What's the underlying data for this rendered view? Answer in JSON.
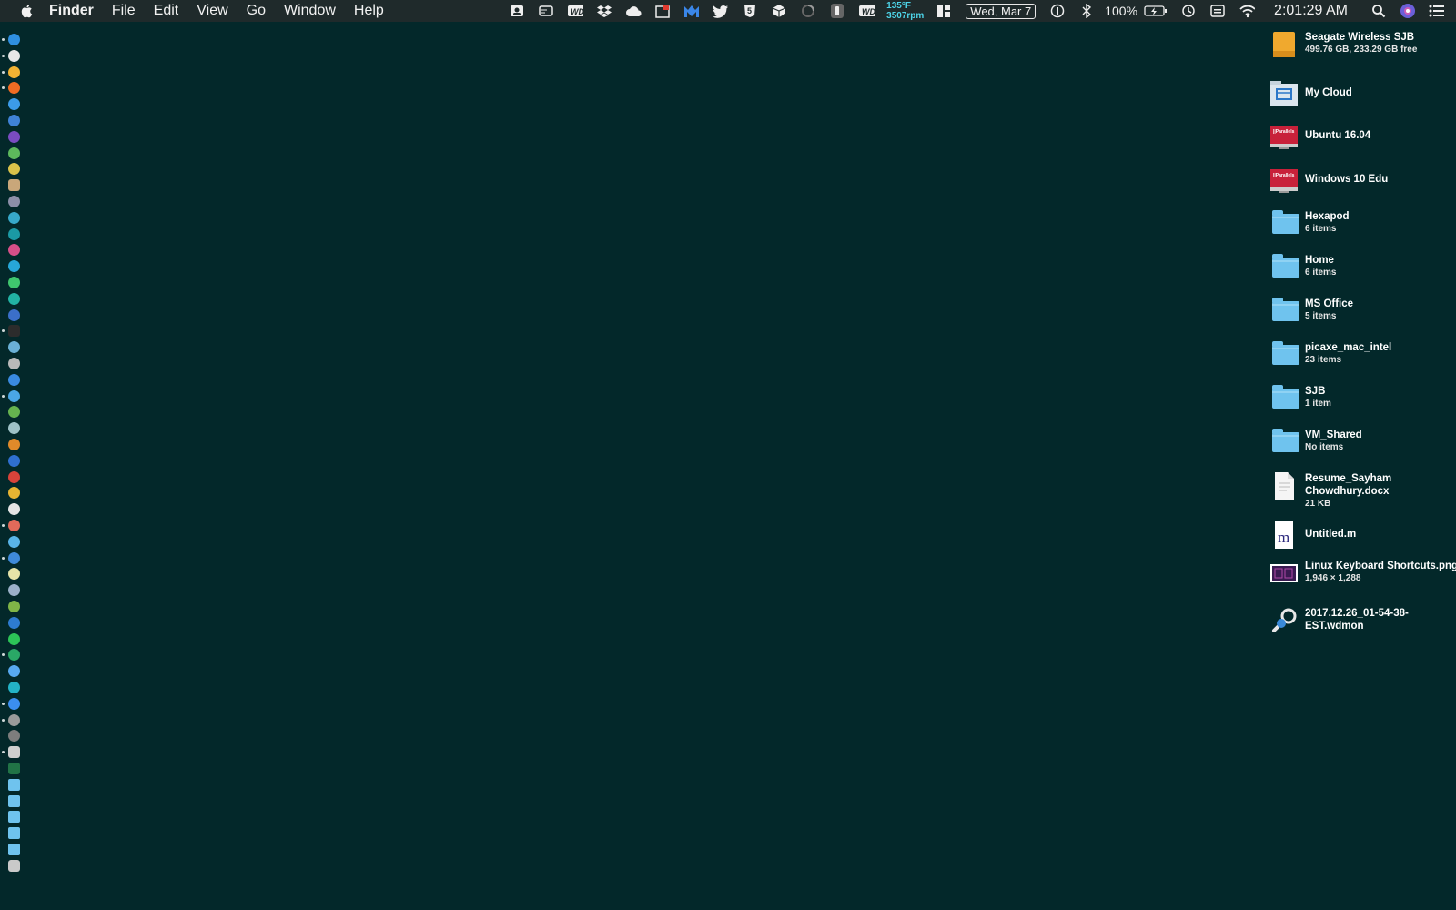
{
  "menubar": {
    "menus": [
      "Finder",
      "File",
      "Edit",
      "View",
      "Go",
      "Window",
      "Help"
    ],
    "status": {
      "temp": "135°F",
      "fan": "3507rpm",
      "date": "Wed, Mar 7",
      "battery": "100%",
      "time": "2:01:29 AM"
    }
  },
  "dock": {
    "apps": [
      {
        "name": "finder",
        "color": "#2f8fe0",
        "dot": true
      },
      {
        "name": "chrome-canary",
        "color": "#e8e8e8",
        "dot": true
      },
      {
        "name": "chrome",
        "color": "#f2b233",
        "dot": true
      },
      {
        "name": "firefox",
        "color": "#ef6b23",
        "dot": true
      },
      {
        "name": "safari",
        "color": "#3c9be8",
        "dot": false
      },
      {
        "name": "xcode",
        "color": "#3f82d6",
        "dot": false
      },
      {
        "name": "visual-studio",
        "color": "#7a4cc0",
        "dot": false
      },
      {
        "name": "app-green",
        "color": "#5db85c",
        "dot": false
      },
      {
        "name": "app-bee",
        "color": "#d9c24a",
        "dot": false
      },
      {
        "name": "preview",
        "color": "#c9a77a",
        "dot": false
      },
      {
        "name": "app-bar",
        "color": "#8c8fa8",
        "dot": false
      },
      {
        "name": "app-teal",
        "color": "#37a8c9",
        "dot": false
      },
      {
        "name": "arduino",
        "color": "#1b9aa4",
        "dot": false
      },
      {
        "name": "intellij",
        "color": "#d64f88",
        "dot": false
      },
      {
        "name": "webstorm",
        "color": "#27a7d8",
        "dot": false
      },
      {
        "name": "pycharm",
        "color": "#3fc66e",
        "dot": false
      },
      {
        "name": "clion",
        "color": "#22b3a4",
        "dot": false
      },
      {
        "name": "app-blue",
        "color": "#3b6fc9",
        "dot": false
      },
      {
        "name": "terminal",
        "color": "#2c2c2c",
        "dot": true
      },
      {
        "name": "app-stripe",
        "color": "#6ab0d6",
        "dot": false
      },
      {
        "name": "app-gray",
        "color": "#b9b9b9",
        "dot": false
      },
      {
        "name": "app-map",
        "color": "#3a8ae0",
        "dot": false
      },
      {
        "name": "twitter",
        "color": "#4aa6e6",
        "dot": true
      },
      {
        "name": "app-lime",
        "color": "#66b34f",
        "dot": false
      },
      {
        "name": "app-person",
        "color": "#9fc2c7",
        "dot": false
      },
      {
        "name": "app-orange",
        "color": "#e08a2a",
        "dot": false
      },
      {
        "name": "app-wave",
        "color": "#2f6fd0",
        "dot": false
      },
      {
        "name": "app-red",
        "color": "#d8433a",
        "dot": false
      },
      {
        "name": "app-yellow",
        "color": "#e7b432",
        "dot": false
      },
      {
        "name": "app-plane",
        "color": "#e4e4e4",
        "dot": false
      },
      {
        "name": "app-robot",
        "color": "#e26a5a",
        "dot": true
      },
      {
        "name": "app-rainbow",
        "color": "#59b4e8",
        "dot": false
      },
      {
        "name": "onepassword",
        "color": "#3f8ad9",
        "dot": true
      },
      {
        "name": "app-pale",
        "color": "#e5e3a8",
        "dot": false
      },
      {
        "name": "virtualbox",
        "color": "#9bb0c8",
        "dot": false
      },
      {
        "name": "android-studio",
        "color": "#80b547",
        "dot": false
      },
      {
        "name": "app-music",
        "color": "#2d7bd0",
        "dot": false
      },
      {
        "name": "spotify",
        "color": "#2cc457",
        "dot": false
      },
      {
        "name": "app-g",
        "color": "#2aa866",
        "dot": true
      },
      {
        "name": "messages",
        "color": "#58a9f0",
        "dot": false
      },
      {
        "name": "app-cyan",
        "color": "#23b3c7",
        "dot": false
      },
      {
        "name": "app-store",
        "color": "#3b8ef0",
        "dot": true
      },
      {
        "name": "system-prefs",
        "color": "#9a9a9a",
        "dot": true
      },
      {
        "name": "app-dark",
        "color": "#7d7d7d",
        "dot": false
      },
      {
        "name": "app-sheet",
        "color": "#cfcfcf",
        "dot": true
      },
      {
        "name": "excel",
        "color": "#217346",
        "dot": false
      },
      {
        "name": "folder-1",
        "color": "#6fc3ee",
        "dot": false
      },
      {
        "name": "folder-2",
        "color": "#6fc3ee",
        "dot": false
      },
      {
        "name": "folder-3",
        "color": "#6fc3ee",
        "dot": false
      },
      {
        "name": "folder-4",
        "color": "#6fc3ee",
        "dot": false
      },
      {
        "name": "folder-5",
        "color": "#6fc3ee",
        "dot": false
      },
      {
        "name": "trash",
        "color": "#c9c9c9",
        "dot": false
      }
    ]
  },
  "desktop": {
    "items": [
      {
        "kind": "drive",
        "name": "Seagate Wireless SJB",
        "sub": "499.76 GB, 233.29 GB free"
      },
      {
        "kind": "network",
        "name": "My Cloud",
        "sub": ""
      },
      {
        "kind": "vm",
        "name": "Ubuntu 16.04",
        "sub": ""
      },
      {
        "kind": "vm",
        "name": "Windows 10 Edu",
        "sub": ""
      },
      {
        "kind": "folder",
        "name": "Hexapod",
        "sub": "6 items"
      },
      {
        "kind": "folder",
        "name": "Home",
        "sub": "6 items"
      },
      {
        "kind": "folder",
        "name": "MS Office",
        "sub": "5 items"
      },
      {
        "kind": "folder",
        "name": "picaxe_mac_intel",
        "sub": "23 items"
      },
      {
        "kind": "folder",
        "name": "SJB",
        "sub": "1 item"
      },
      {
        "kind": "folder",
        "name": "VM_Shared",
        "sub": "No items"
      },
      {
        "kind": "docx",
        "name": "Resume_Sayham Chowdhury.docx",
        "sub": "21 KB"
      },
      {
        "kind": "mfile",
        "name": "Untitled.m",
        "sub": ""
      },
      {
        "kind": "png",
        "name": "Linux Keyboard Shortcuts.png",
        "sub": "1,946 × 1,288"
      },
      {
        "kind": "wdmon",
        "name": "2017.12.26_01-54-38-EST.wdmon",
        "sub": ""
      }
    ]
  }
}
